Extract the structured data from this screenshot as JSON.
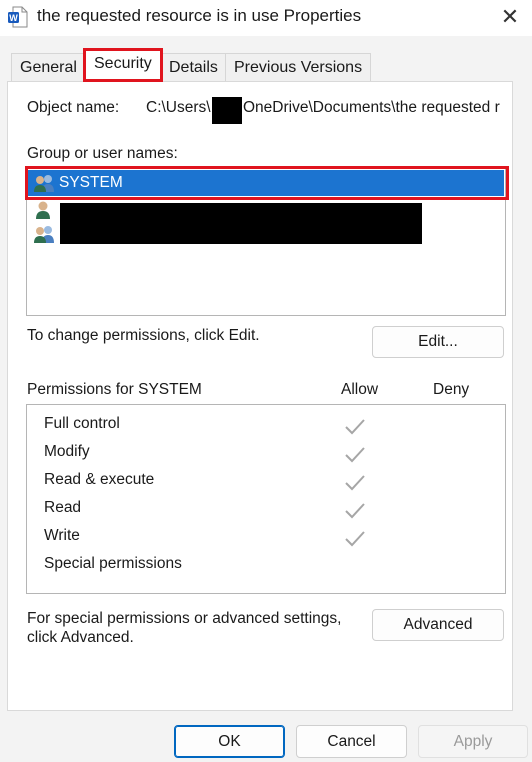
{
  "window": {
    "title": "the requested resource is in use Properties",
    "close_glyph": "✕",
    "app_icon": "word-document-icon"
  },
  "tabs": [
    {
      "label": "General",
      "active": false
    },
    {
      "label": "Security",
      "active": true
    },
    {
      "label": "Details",
      "active": false
    },
    {
      "label": "Previous Versions",
      "active": false
    }
  ],
  "security": {
    "object_name_label": "Object name:",
    "object_path_prefix": "C:\\Users\\",
    "object_path_suffix": "OneDrive\\Documents\\the requested r",
    "group_label": "Group or user names:",
    "users": [
      {
        "name": "SYSTEM",
        "selected": true,
        "icon": "user-group-icon"
      },
      {
        "name": "",
        "selected": false,
        "icon": "user-icon",
        "redacted": true
      },
      {
        "name": ")",
        "selected": false,
        "icon": "user-group-icon",
        "redacted": true
      }
    ],
    "change_text": "To change permissions, click Edit.",
    "edit_button": "Edit...",
    "permissions_header": "Permissions for SYSTEM",
    "allow_header": "Allow",
    "deny_header": "Deny",
    "permissions": [
      {
        "name": "Full control",
        "allow": true,
        "deny": false
      },
      {
        "name": "Modify",
        "allow": true,
        "deny": false
      },
      {
        "name": "Read & execute",
        "allow": true,
        "deny": false
      },
      {
        "name": "Read",
        "allow": true,
        "deny": false
      },
      {
        "name": "Write",
        "allow": true,
        "deny": false
      },
      {
        "name": "Special permissions",
        "allow": false,
        "deny": false
      }
    ],
    "advanced_text_1": "For special permissions or advanced settings,",
    "advanced_text_2": "click Advanced.",
    "advanced_button": "Advanced"
  },
  "footer": {
    "ok": "OK",
    "cancel": "Cancel",
    "apply": "Apply"
  },
  "colors": {
    "selection": "#1c74d0",
    "highlight_outline": "#e0141e",
    "check_gray": "#a6a6a6",
    "accent": "#0067c0"
  }
}
